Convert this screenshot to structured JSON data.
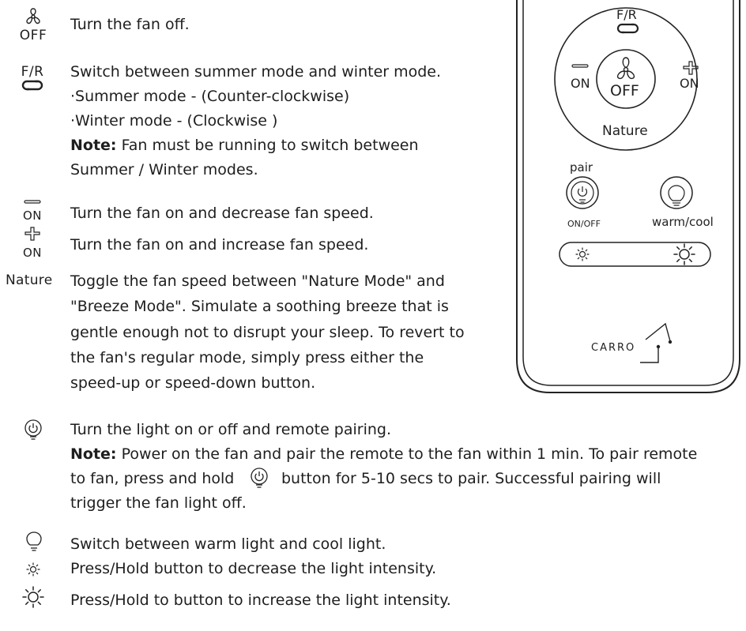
{
  "instructions": [
    {
      "icon_label": "OFF",
      "text": "Turn the fan off."
    },
    {
      "icon_label": "F/R",
      "text": "Switch between summer mode and winter mode.",
      "sub1": "·Summer mode - (Counter-clockwise)",
      "sub2": "·Winter mode - (Clockwise )",
      "note_label": "Note:",
      "note": " Fan must be running to switch between",
      "note2": "Summer / Winter modes."
    },
    {
      "icon_label": "ON",
      "text": "Turn the fan on and decrease fan speed."
    },
    {
      "icon_label": "ON",
      "text": "Turn the fan on and increase fan speed."
    },
    {
      "icon_label": "Nature",
      "line1": "Toggle the fan speed between \"Nature Mode\" and",
      "line2": "\"Breeze Mode\". Simulate a soothing breeze that is",
      "line3": "gentle enough not to disrupt your sleep. To revert to",
      "line4": "the fan's regular mode, simply press either the",
      "line5": "speed-up or speed-down button."
    },
    {
      "text": "Turn the light on or off and remote pairing.",
      "note_label": "Note:",
      "note": " Power on the fan and pair the remote to the fan within 1 min. To pair remote",
      "note2a": "to fan, press and hold",
      "note2b": "button for 5-10 secs to pair. Successful pairing will",
      "note3": "trigger the fan light off."
    },
    {
      "text": "Switch between warm light and cool light."
    },
    {
      "text": "Press/Hold button to decrease the light intensity."
    },
    {
      "text": "Press/Hold to button to increase the light intensity."
    }
  ],
  "remote": {
    "fr": "F/R",
    "minus_on": "ON",
    "plus_on": "ON",
    "off": "OFF",
    "nature": "Nature",
    "pair": "pair",
    "onoff": "ON/OFF",
    "warmcool": "warm/cool",
    "brand": "CARRO"
  }
}
